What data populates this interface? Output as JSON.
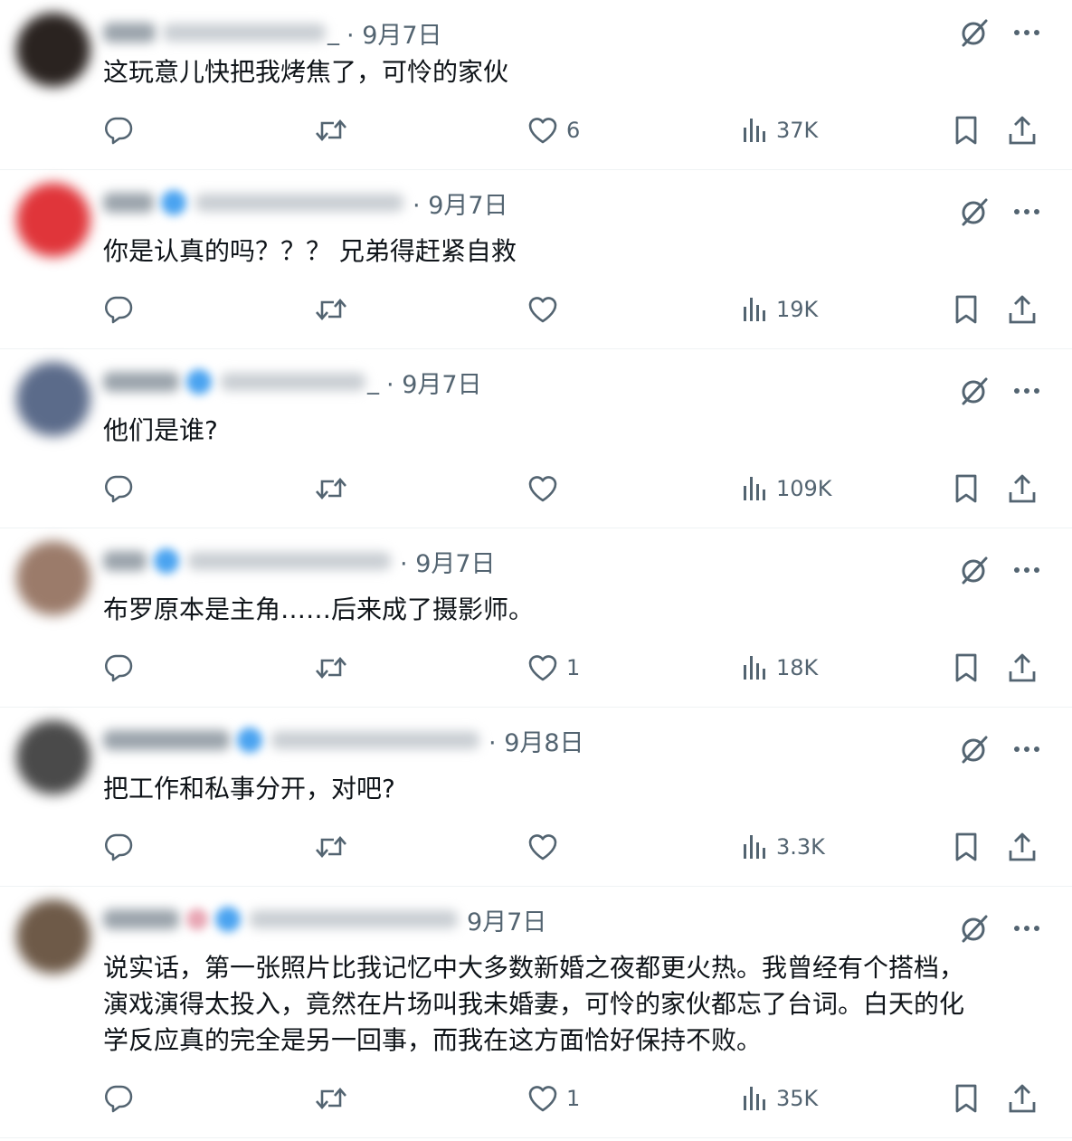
{
  "replies": [
    {
      "handle_tail": "_",
      "separator": "·",
      "date": "9月7日",
      "text": "这玩意儿快把我烤焦了，可怜的家伙",
      "likes": "6",
      "views": "37K"
    },
    {
      "handle_tail": "",
      "separator": "·",
      "date": "9月7日",
      "text": "你是认真的吗？？？ 兄弟得赶紧自救",
      "likes": "",
      "views": "19K"
    },
    {
      "handle_tail": "_",
      "separator": "·",
      "date": "9月7日",
      "text": "他们是谁?",
      "likes": "",
      "views": "109K"
    },
    {
      "handle_tail": "",
      "separator": "·",
      "date": "9月7日",
      "text": "布罗原本是主角……后来成了摄影师。",
      "likes": "1",
      "views": "18K"
    },
    {
      "handle_tail": "",
      "separator": "·",
      "date": "9月8日",
      "text": "把工作和私事分开，对吧?",
      "likes": "",
      "views": "3.3K"
    },
    {
      "handle_tail": "",
      "separator": "",
      "date": "9月7日",
      "text": "说实话，第一张照片比我记忆中大多数新婚之夜都更火热。我曾经有个搭档，\n演戏演得太投入，竟然在片场叫我未婚妻，可怜的家伙都忘了台词。白天的化\n学反应真的完全是另一回事，而我在这方面恰好保持不败。",
      "likes": "1",
      "views": "35K"
    }
  ],
  "icons": {
    "reply": "reply-icon",
    "retweet": "retweet-icon",
    "like": "like-icon",
    "views": "views-icon",
    "bookmark": "bookmark-icon",
    "share": "share-icon",
    "grok": "grok-icon",
    "more": "more-icon"
  },
  "colors": {
    "text": "#0f1419",
    "secondary": "#536471",
    "divider": "#eff3f4",
    "verified": "#1d9bf0"
  }
}
